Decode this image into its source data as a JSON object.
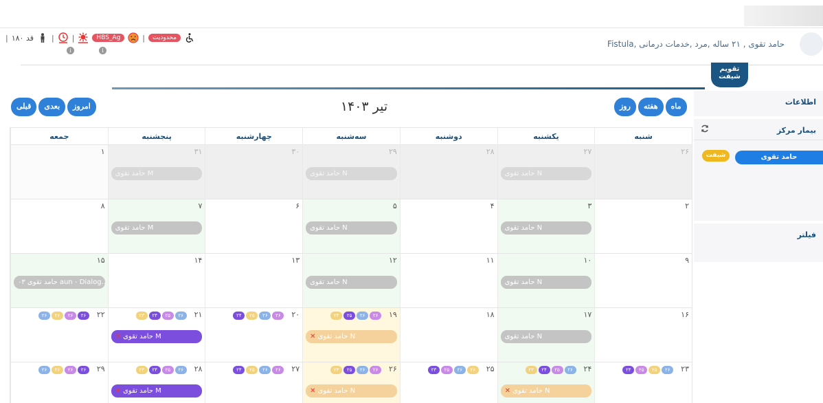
{
  "header": {
    "height": "قد ۱۸۰",
    "separator": "|",
    "hbs_badge": "HBS_Ag",
    "restriction_badge": "محدودیت",
    "patient": "حامد تقوی , ۲۱ ساله ,مرد ,خدمات درمانی ,Fistula"
  },
  "shift_tab": "تقویم شیفت",
  "calendar": {
    "title": "تیر ۱۴۰۳",
    "nav": {
      "prev": "قبلی",
      "next": "بعدی",
      "today": "امروز"
    },
    "views": {
      "month": "ماه",
      "week": "هفته",
      "day": "روز"
    },
    "weekdays": [
      "جمعه",
      "پنجشنبه",
      "چهارشنبه",
      "سه‌شنبه",
      "دوشنبه",
      "یکشنبه",
      "شنبه"
    ],
    "weeks": [
      [
        {
          "n": "۱",
          "kind": "blank"
        },
        {
          "n": "۳۱",
          "kind": "dim",
          "event": "حامد تقوی M",
          "style": "dimgray"
        },
        {
          "n": "۳۰",
          "kind": "dim"
        },
        {
          "n": "۲۹",
          "kind": "dim",
          "event": "حامد تقوی N",
          "style": "dimgray"
        },
        {
          "n": "۲۸",
          "kind": "dim"
        },
        {
          "n": "۲۷",
          "kind": "dim",
          "event": "حامد تقوی N",
          "style": "dimgray"
        },
        {
          "n": "۲۶",
          "kind": "dim"
        }
      ],
      [
        {
          "n": "۸",
          "kind": "plain"
        },
        {
          "n": "۷",
          "kind": "green",
          "event": "حامد تقوی M",
          "style": "gray"
        },
        {
          "n": "۶",
          "kind": "plain"
        },
        {
          "n": "۵",
          "kind": "green",
          "event": "حامد تقوی N",
          "style": "gray"
        },
        {
          "n": "۴",
          "kind": "plain"
        },
        {
          "n": "۳",
          "kind": "green",
          "event": "حامد تقوی N",
          "style": "gray"
        },
        {
          "n": "۲",
          "kind": "plain"
        }
      ],
      [
        {
          "n": "۱۵",
          "kind": "green",
          "event": "حامد تقوی ۰۳ aun - Dialog...",
          "style": "gray"
        },
        {
          "n": "۱۴",
          "kind": "plain"
        },
        {
          "n": "۱۳",
          "kind": "plain"
        },
        {
          "n": "۱۲",
          "kind": "green",
          "event": "حامد تقوی N",
          "style": "gray"
        },
        {
          "n": "۱۱",
          "kind": "plain"
        },
        {
          "n": "۱۰",
          "kind": "green",
          "event": "حامد تقوی N",
          "style": "gray"
        },
        {
          "n": "۹",
          "kind": "plain"
        }
      ],
      [
        {
          "n": "۲۲",
          "kind": "plain",
          "dots": [
            {
              "t": "۲۶",
              "c": "d-blue"
            },
            {
              "t": "۲۶",
              "c": "d-yellow"
            },
            {
              "t": "۲۶",
              "c": "d-pink"
            },
            {
              "t": "۲۶",
              "c": "d-purple"
            }
          ]
        },
        {
          "n": "۲۱",
          "kind": "plain",
          "event": "حامد تقوی M",
          "style": "purple",
          "cancel": true,
          "dots": [
            {
              "t": "۲۳",
              "c": "d-yellow"
            },
            {
              "t": "۲۴",
              "c": "d-purple"
            },
            {
              "t": "۲۵",
              "c": "d-pink"
            },
            {
              "t": "۲۶",
              "c": "d-blue"
            }
          ]
        },
        {
          "n": "۲۰",
          "kind": "plain",
          "dots": [
            {
              "t": "۲۴",
              "c": "d-purple"
            },
            {
              "t": "۲۵",
              "c": "d-yellow"
            },
            {
              "t": "۲۶",
              "c": "d-blue"
            },
            {
              "t": "۲۶",
              "c": "d-pink"
            }
          ]
        },
        {
          "n": "۱۹",
          "kind": "today",
          "event": "حامد تقوی N",
          "style": "peach",
          "cancel": true,
          "dots": [
            {
              "t": "۲۳",
              "c": "d-yellow"
            },
            {
              "t": "۲۵",
              "c": "d-purple"
            },
            {
              "t": "۲۶",
              "c": "d-blue"
            },
            {
              "t": "۲۶",
              "c": "d-pink"
            }
          ]
        },
        {
          "n": "۱۸",
          "kind": "plain"
        },
        {
          "n": "۱۷",
          "kind": "green",
          "event": "حامد تقوی N",
          "style": "gray"
        },
        {
          "n": "۱۶",
          "kind": "plain"
        }
      ],
      [
        {
          "n": "۲۹",
          "kind": "plain",
          "dots": [
            {
              "t": "۲۶",
              "c": "d-blue"
            },
            {
              "t": "۲۶",
              "c": "d-yellow"
            },
            {
              "t": "۲۶",
              "c": "d-pink"
            },
            {
              "t": "۲۶",
              "c": "d-purple"
            }
          ]
        },
        {
          "n": "۲۸",
          "kind": "plain",
          "event": "حامد تقوی M",
          "style": "purple",
          "cancel": true,
          "dots": [
            {
              "t": "۲۳",
              "c": "d-yellow"
            },
            {
              "t": "۲۴",
              "c": "d-purple"
            },
            {
              "t": "۲۵",
              "c": "d-pink"
            },
            {
              "t": "۲۶",
              "c": "d-blue"
            }
          ]
        },
        {
          "n": "۲۷",
          "kind": "plain",
          "dots": [
            {
              "t": "۲۴",
              "c": "d-purple"
            },
            {
              "t": "۲۵",
              "c": "d-yellow"
            },
            {
              "t": "۲۶",
              "c": "d-blue"
            },
            {
              "t": "۲۶",
              "c": "d-pink"
            }
          ]
        },
        {
          "n": "۲۶",
          "kind": "today",
          "event": "حامد تقوی N",
          "style": "peach",
          "cancel": true,
          "dots": [
            {
              "t": "۲۳",
              "c": "d-yellow"
            },
            {
              "t": "۲۵",
              "c": "d-purple"
            },
            {
              "t": "۲۶",
              "c": "d-blue"
            },
            {
              "t": "۲۶",
              "c": "d-pink"
            }
          ]
        },
        {
          "n": "۲۵",
          "kind": "plain",
          "dots": [
            {
              "t": "۲۳",
              "c": "d-purple"
            },
            {
              "t": "۲۵",
              "c": "d-pink"
            },
            {
              "t": "۲۶",
              "c": "d-blue"
            },
            {
              "t": "۲۶",
              "c": "d-yellow"
            }
          ]
        },
        {
          "n": "۲۴",
          "kind": "green",
          "event": "حامد تقوی N",
          "style": "peach",
          "cancel": true,
          "dots": [
            {
              "t": "۲۳",
              "c": "d-yellow"
            },
            {
              "t": "۲۴",
              "c": "d-purple"
            },
            {
              "t": "۲۵",
              "c": "d-pink"
            },
            {
              "t": "۲۶",
              "c": "d-blue"
            }
          ]
        },
        {
          "n": "۲۳",
          "kind": "plain",
          "dots": [
            {
              "t": "۲۴",
              "c": "d-purple"
            },
            {
              "t": "۲۵",
              "c": "d-pink"
            },
            {
              "t": "۲۵",
              "c": "d-yellow"
            },
            {
              "t": "۲۶",
              "c": "d-blue"
            }
          ]
        }
      ]
    ]
  },
  "side": {
    "info": "اطلاعات",
    "center_patient": "بیمار مرکز",
    "person": "حامد تقوی",
    "shift": "شیفت",
    "filter": "فیلتر"
  }
}
